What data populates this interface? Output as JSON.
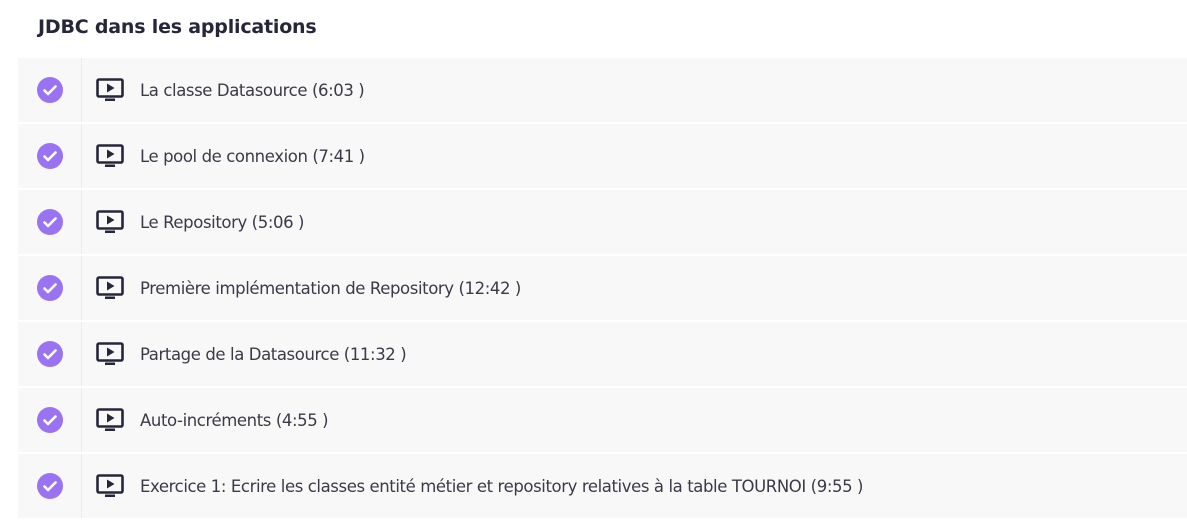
{
  "section": {
    "title": "JDBC dans les applications"
  },
  "icons": {
    "status": "check-circle-icon",
    "type": "video-play-icon"
  },
  "colors": {
    "accent": "#9a73f2",
    "row_background": "#f8f8f9"
  },
  "lessons": [
    {
      "title": "La classe Datasource (6:03 )",
      "completed": true
    },
    {
      "title": "Le pool de connexion (7:41 )",
      "completed": true
    },
    {
      "title": "Le Repository (5:06 )",
      "completed": true
    },
    {
      "title": "Première implémentation de Repository (12:42 )",
      "completed": true
    },
    {
      "title": "Partage de la Datasource (11:32 )",
      "completed": true
    },
    {
      "title": "Auto-incréments (4:55 )",
      "completed": true
    },
    {
      "title": "Exercice 1: Ecrire les classes entité métier et repository relatives à la table TOURNOI (9:55 )",
      "completed": true
    }
  ]
}
